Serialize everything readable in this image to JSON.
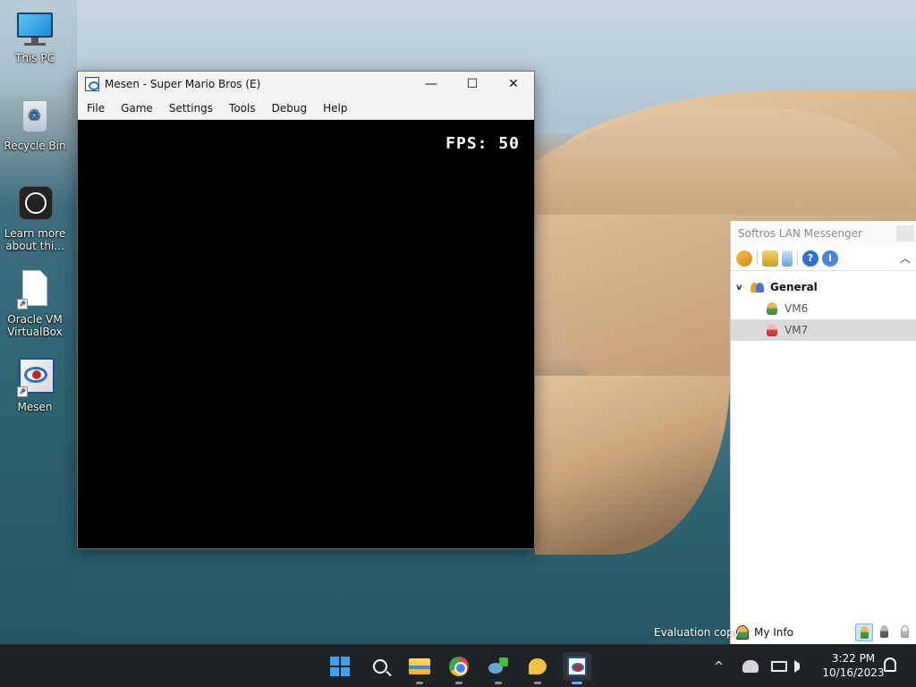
{
  "desktop": {
    "icons": [
      {
        "label": "This PC",
        "icon": "this-pc-icon"
      },
      {
        "label": "Recycle Bin",
        "icon": "recycle-bin-icon"
      },
      {
        "label": "Learn more about thi...",
        "icon": "learn-more-icon"
      },
      {
        "label": "Oracle VM VirtualBox",
        "icon": "virtualbox-shortcut-icon"
      },
      {
        "label": "Mesen",
        "icon": "mesen-shortcut-icon"
      }
    ],
    "watermark": "Evaluation copy"
  },
  "mesen_window": {
    "title": "Mesen - Super Mario Bros (E)",
    "controls": {
      "minimize": "—",
      "maximize": "☐",
      "close": "✕"
    },
    "menu": [
      "File",
      "Game",
      "Settings",
      "Tools",
      "Debug",
      "Help"
    ],
    "fps_text": "FPS: 50"
  },
  "messenger": {
    "title": "Softros LAN Messenger",
    "toolbar_icons": [
      "people-icon",
      "folder-icon",
      "list-icon",
      "help-icon",
      "info-icon",
      "collapse-icon"
    ],
    "group": {
      "name": "General",
      "expanded": true
    },
    "users": [
      {
        "name": "VM6",
        "status": "online",
        "selected": false
      },
      {
        "name": "VM7",
        "status": "away",
        "selected": true
      }
    ],
    "my_info_label": "My Info"
  },
  "taskbar": {
    "apps": [
      "start-icon",
      "search-icon",
      "file-explorer-icon",
      "chrome-icon",
      "network-app-icon",
      "chat-app-icon",
      "mesen-app-icon"
    ],
    "tray": {
      "show_hidden": "^",
      "time": "3:22 PM",
      "date": "10/16/2023"
    }
  },
  "colors": {
    "taskbar": "#1f2226",
    "accent": "#5fb0f0",
    "mesen_blue": "#1b4f9c"
  }
}
